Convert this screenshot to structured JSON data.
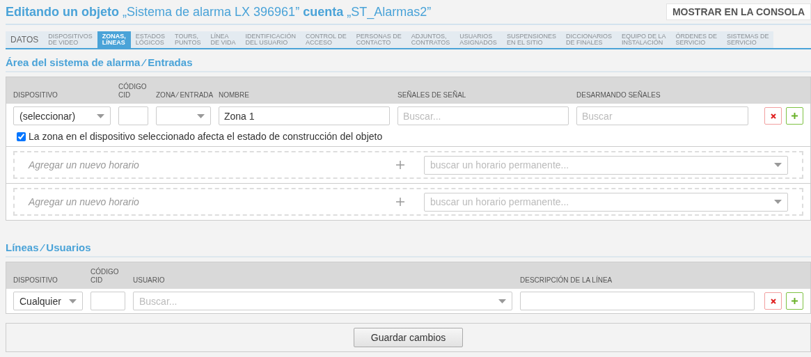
{
  "header": {
    "title_parts": [
      {
        "kind": "bold",
        "text": "Editando un objeto"
      },
      {
        "kind": "plain",
        "text": "„Sistema de alarma LX 396961”"
      },
      {
        "kind": "bold",
        "text": "cuenta"
      },
      {
        "kind": "plain",
        "text": "„ST_Alarmas2”"
      }
    ],
    "console_button": "MOSTRAR EN LA CONSOLA"
  },
  "tabs": [
    {
      "label": "DATOS",
      "selected": false,
      "kind": "single"
    },
    {
      "label": "DISPOSITIVOS\nDE VIDEO",
      "selected": false,
      "kind": "double"
    },
    {
      "label": "ZONAS,\nLÍNEAS",
      "selected": true,
      "kind": "double"
    },
    {
      "label": "ESTADOS\nLÓGICOS",
      "selected": false,
      "kind": "double"
    },
    {
      "label": "TOURS,\nPUNTOS",
      "selected": false,
      "kind": "double"
    },
    {
      "label": "LÍNEA\nDE VIDA",
      "selected": false,
      "kind": "double"
    },
    {
      "label": "IDENTIFICACIÓN\nDEL USUARIO",
      "selected": false,
      "kind": "double"
    },
    {
      "label": "CONTROL DE\nACCESO",
      "selected": false,
      "kind": "double"
    },
    {
      "label": "PERSONAS DE\nCONTACTO",
      "selected": false,
      "kind": "double"
    },
    {
      "label": "ADJUNTOS,\nCONTRATOS",
      "selected": false,
      "kind": "double"
    },
    {
      "label": "USUARIOS\nASIGNADOS",
      "selected": false,
      "kind": "double"
    },
    {
      "label": "SUSPENSIONES\nEN EL SITIO",
      "selected": false,
      "kind": "double"
    },
    {
      "label": "DICCIONARIOS\nDE FINALES",
      "selected": false,
      "kind": "double"
    },
    {
      "label": "EQUIPO DE LA\nINSTALACIÓN",
      "selected": false,
      "kind": "double"
    },
    {
      "label": "ÓRDENES DE\nSERVICIO",
      "selected": false,
      "kind": "double"
    },
    {
      "label": "SISTEMAS DE\nSERVICIO",
      "selected": false,
      "kind": "double"
    }
  ],
  "zones": {
    "title": "Área del sistema de alarma ⁄ Entradas",
    "columns": [
      "DISPOSITIVO",
      "CÓDIGO\nCID",
      "ZONA ⁄ ENTRADA",
      "NOMBRE",
      "SEÑALES DE SEÑAL",
      "DESARMANDO SEÑALES"
    ],
    "row": {
      "device": "(seleccionar)",
      "name": "Zona 1",
      "signals_placeholder": "Buscar...",
      "disarm_placeholder": "Buscar"
    },
    "checkbox": {
      "label": "La zona en el dispositivo seleccionado afecta el estado de construcción del objeto",
      "checked": true
    },
    "schedules": [
      {
        "placeholder": "Agregar un nuevo horario",
        "search_placeholder": "buscar un horario permanente..."
      },
      {
        "placeholder": "Agregar un nuevo horario",
        "search_placeholder": "buscar un horario permanente..."
      }
    ]
  },
  "lines": {
    "title": "Líneas ⁄ Usuarios",
    "columns": [
      "DISPOSITIVO",
      "CÓDIGO\nCID",
      "USUARIO",
      "DESCRIPCIÓN DE LA LÍNEA"
    ],
    "row": {
      "device": "Cualquier",
      "user_placeholder": "Buscar..."
    }
  },
  "save_button": "Guardar cambios"
}
